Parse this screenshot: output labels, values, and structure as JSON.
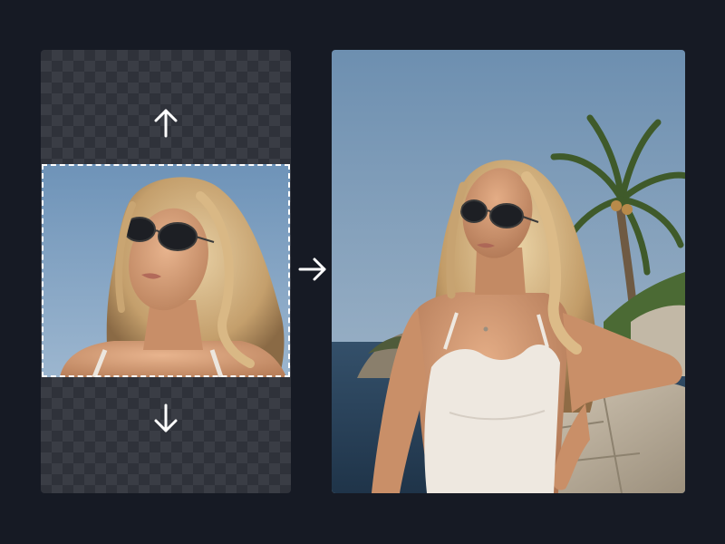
{
  "canvas": {
    "background": "#161a24",
    "transparency_pattern": [
      "#2f323a",
      "#3a3d45"
    ],
    "selection_border_color": "#ffffff"
  },
  "icons": {
    "expand_up": "arrow-up-icon",
    "expand_down": "arrow-down-icon",
    "transform": "arrow-right-icon"
  },
  "source_image": {
    "subject": "woman-with-sunglasses-closeup",
    "sky_color": "#7f9fbf"
  },
  "result_image": {
    "subject": "woman-with-sunglasses-leaning-on-stone-wall",
    "sky_color": "#7e9bb8",
    "sea_color": "#2b4560"
  }
}
